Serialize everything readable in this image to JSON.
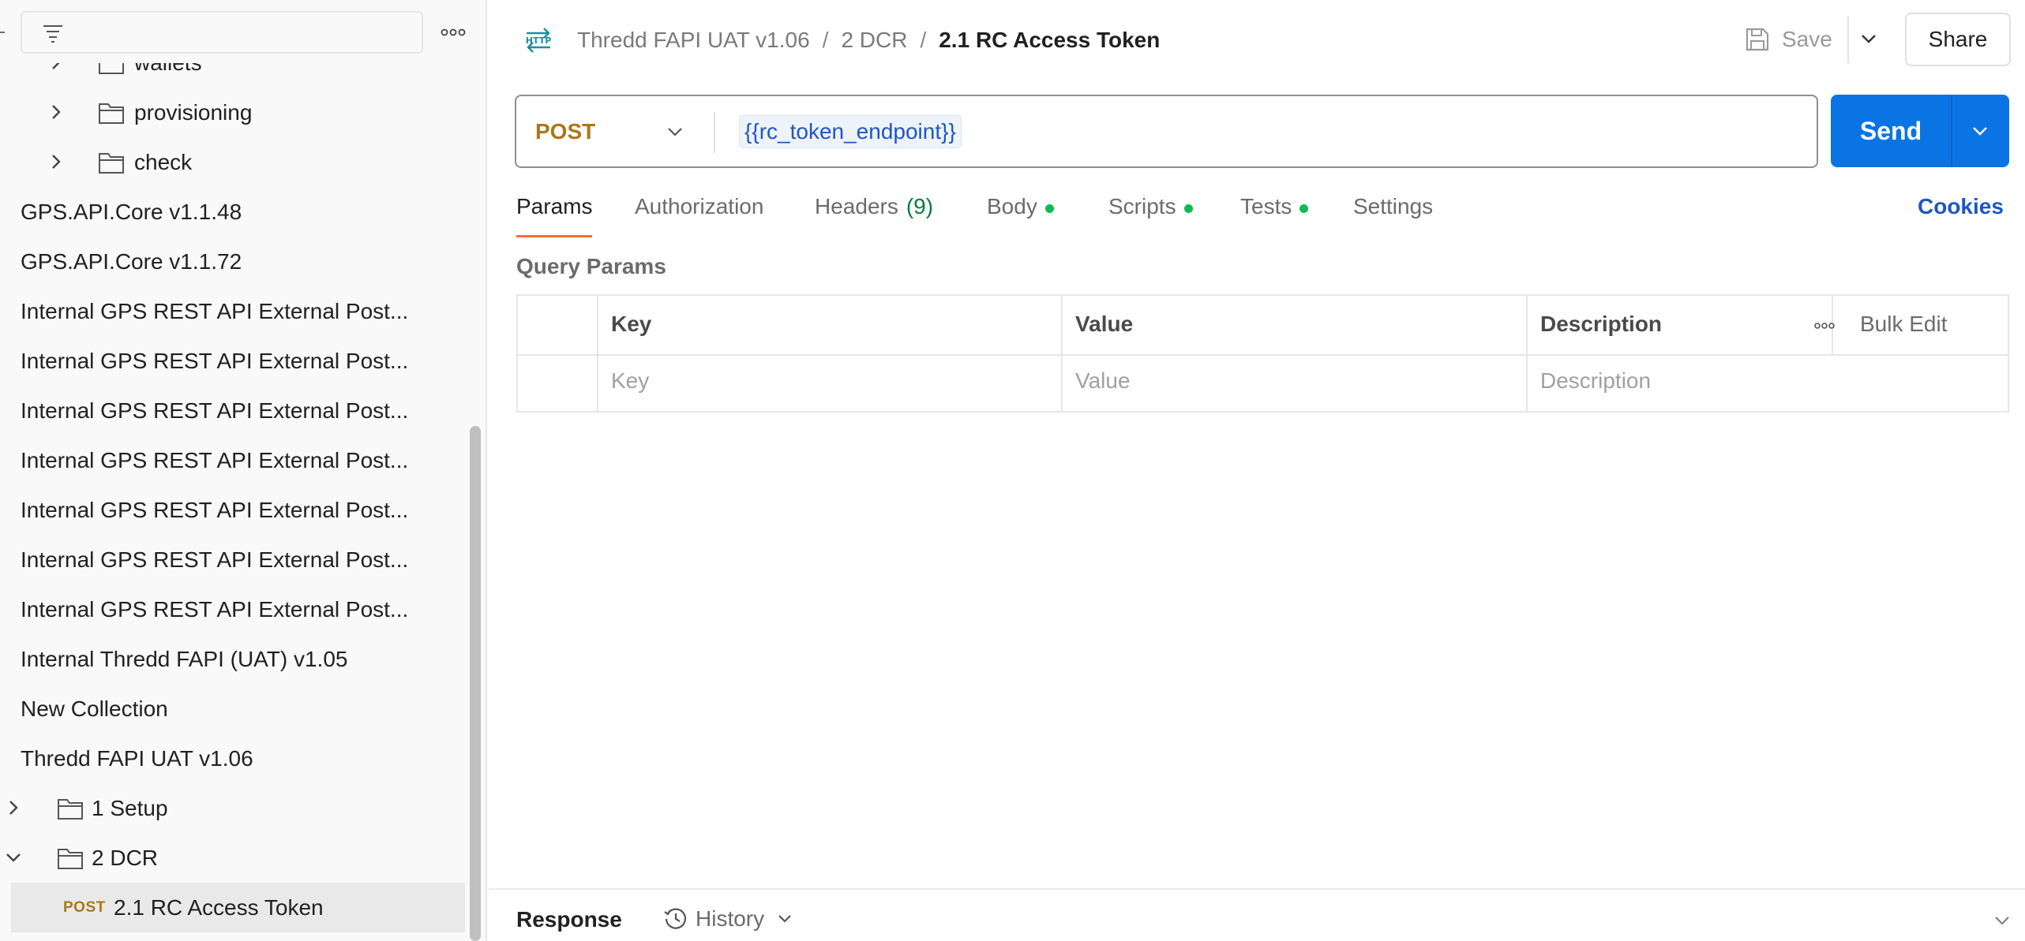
{
  "sidebar": {
    "top_partial_label": "wallets",
    "items": [
      {
        "label": "provisioning",
        "type": "folder",
        "expanded": false
      },
      {
        "label": "check",
        "type": "folder",
        "expanded": false
      },
      {
        "label": "GPS.API.Core v1.1.48",
        "type": "collection"
      },
      {
        "label": "GPS.API.Core v1.1.72",
        "type": "collection"
      },
      {
        "label": "Internal GPS REST API External Post...",
        "type": "collection"
      },
      {
        "label": "Internal GPS REST API External Post...",
        "type": "collection"
      },
      {
        "label": "Internal GPS REST API External Post...",
        "type": "collection"
      },
      {
        "label": "Internal GPS REST API External Post...",
        "type": "collection"
      },
      {
        "label": "Internal GPS REST API External Post...",
        "type": "collection"
      },
      {
        "label": "Internal GPS REST API External Post...",
        "type": "collection"
      },
      {
        "label": "Internal GPS REST API External Post...",
        "type": "collection"
      },
      {
        "label": "Internal Thredd FAPI (UAT) v1.05",
        "type": "collection"
      },
      {
        "label": "New Collection",
        "type": "collection"
      },
      {
        "label": "Thredd FAPI UAT v1.06",
        "type": "collection"
      },
      {
        "label": "1 Setup",
        "type": "folder",
        "expanded": false
      },
      {
        "label": "2 DCR",
        "type": "folder",
        "expanded": true
      },
      {
        "label": "2.1 RC Access Token",
        "type": "request",
        "method": "POST",
        "selected": true
      }
    ]
  },
  "header": {
    "icon": "http-icon",
    "breadcrumb": [
      "Thredd FAPI UAT v1.06",
      "2 DCR",
      "2.1 RC Access Token"
    ],
    "separator": "/",
    "save_label": "Save",
    "share_label": "Share"
  },
  "request": {
    "method": "POST",
    "url": "{{rc_token_endpoint}}",
    "send_label": "Send"
  },
  "tabs": [
    {
      "label": "Params",
      "active": true
    },
    {
      "label": "Authorization"
    },
    {
      "label": "Headers",
      "count": "(9)"
    },
    {
      "label": "Body",
      "dot": true
    },
    {
      "label": "Scripts",
      "dot": true
    },
    {
      "label": "Tests",
      "dot": true
    },
    {
      "label": "Settings"
    }
  ],
  "cookies_label": "Cookies",
  "query_params": {
    "title": "Query Params",
    "columns": [
      "Key",
      "Value",
      "Description"
    ],
    "placeholders": [
      "Key",
      "Value",
      "Description"
    ],
    "bulk_edit_label": "Bulk Edit"
  },
  "response": {
    "title": "Response",
    "history_label": "History"
  },
  "colors": {
    "accent_blue": "#0b74e5",
    "method_post": "#a8781a",
    "tab_underline": "#ff6c37",
    "dot_green": "#0cbb52",
    "link_blue": "#1d57c4"
  }
}
